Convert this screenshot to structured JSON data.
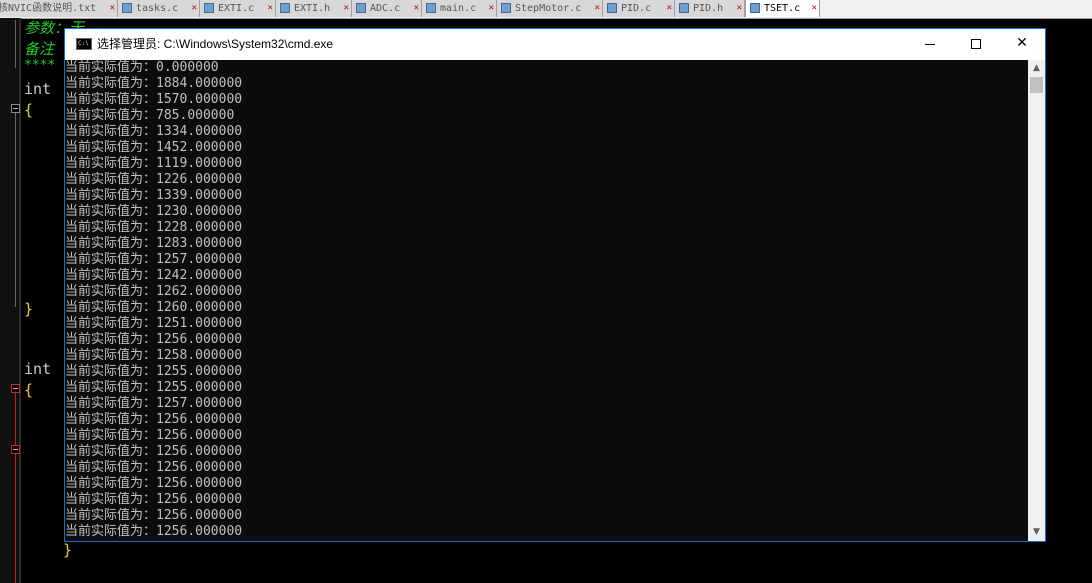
{
  "editor": {
    "tabs": [
      {
        "label": "核NVIC函数说明.txt",
        "active": false
      },
      {
        "label": "tasks.c",
        "active": false
      },
      {
        "label": "EXTI.c",
        "active": false
      },
      {
        "label": "EXTI.h",
        "active": false
      },
      {
        "label": "ADC.c",
        "active": false
      },
      {
        "label": "main.c",
        "active": false
      },
      {
        "label": "StepMotor.c",
        "active": false
      },
      {
        "label": "PID.c",
        "active": false
      },
      {
        "label": "PID.h",
        "active": false
      },
      {
        "label": "TSET.c",
        "active": true
      }
    ],
    "code": {
      "comment_params": "参数：无",
      "comment_notes": "备注",
      "stars": "****",
      "kw_int_1": "int",
      "brace_open_1": "{",
      "brace_close_1": "}",
      "kw_int_2": "int",
      "brace_open_2": "{",
      "brace_close_2": "}"
    },
    "colors": {
      "comment": "#22c82a",
      "brace": "#e8d030",
      "keyword": "#c8c8c8"
    }
  },
  "cmd_window": {
    "title": "选择管理员: C:\\Windows\\System32\\cmd.exe",
    "icon": "console-app-icon",
    "min_label": "",
    "max_label": "",
    "close_label": "✕",
    "prefix": "当前实际值为：",
    "lines": [
      "0.000000",
      "1884.000000",
      "1570.000000",
      "785.000000",
      "1334.000000",
      "1452.000000",
      "1119.000000",
      "1226.000000",
      "1339.000000",
      "1230.000000",
      "1228.000000",
      "1283.000000",
      "1257.000000",
      "1242.000000",
      "1262.000000",
      "1260.000000",
      "1251.000000",
      "1256.000000",
      "1258.000000",
      "1255.000000",
      "1255.000000",
      "1257.000000",
      "1256.000000",
      "1256.000000",
      "1256.000000",
      "1256.000000",
      "1256.000000",
      "1256.000000",
      "1256.000000",
      "1256.000000"
    ],
    "scroll_up": "▲",
    "scroll_down": "▼"
  }
}
